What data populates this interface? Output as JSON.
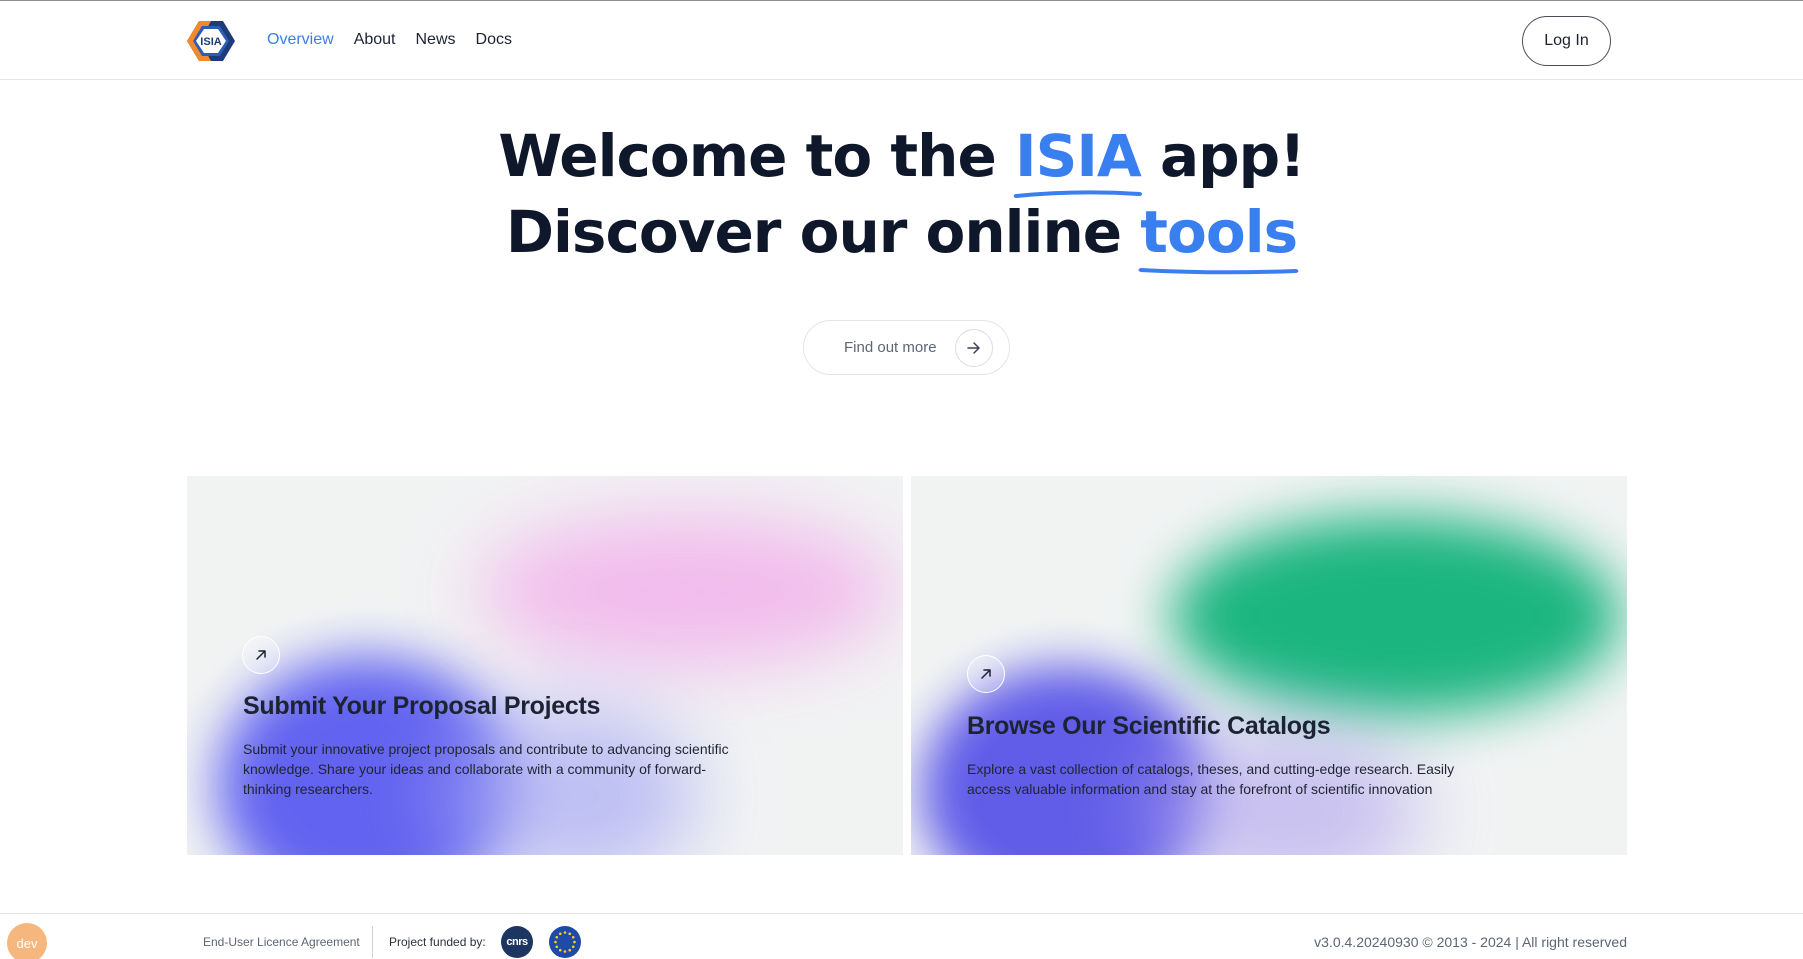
{
  "header": {
    "logo_text": "ISIA",
    "nav": [
      {
        "label": "Overview",
        "active": true
      },
      {
        "label": "About"
      },
      {
        "label": "News"
      },
      {
        "label": "Docs"
      }
    ],
    "login_label": "Log In"
  },
  "hero": {
    "line1_before": "Welcome to the",
    "line1_accent": "ISIA",
    "line1_after": "app!",
    "line2_before": "Discover our online",
    "line2_accent": "tools",
    "cta_label": "Find out more",
    "accent_color": "#3a7ff0"
  },
  "cards": [
    {
      "title": "Submit Your Proposal Projects",
      "description": "Submit your innovative project proposals and contribute to advancing scientific knowledge. Share your ideas and collaborate with a community of forward-thinking researchers.",
      "icon": "arrow-up-right-icon"
    },
    {
      "title": "Browse Our Scientific Catalogs",
      "description": "Explore a vast collection of catalogs, theses, and cutting-edge research. Easily access valuable information and stay at the forefront of scientific innovation",
      "icon": "arrow-up-right-icon"
    }
  ],
  "footer": {
    "env_badge": "dev",
    "eula_label": "End-User Licence Agreement",
    "funded_label": "Project funded by:",
    "cnrs_logo_text": "cnrs",
    "version_text": "v3.0.4.20240930 © 2013 - 2024 | All right reserved"
  }
}
